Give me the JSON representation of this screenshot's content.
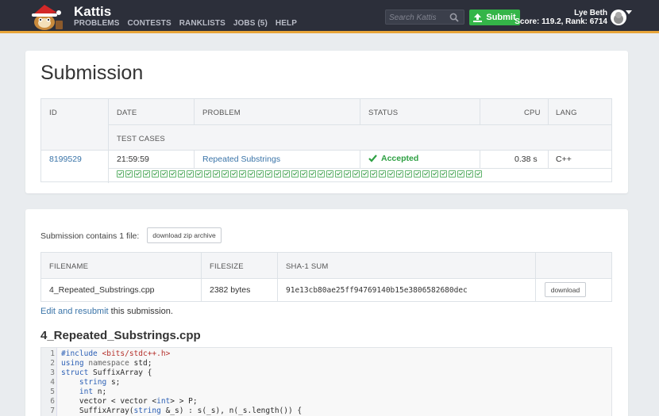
{
  "header": {
    "brand": "Kattis",
    "nav": [
      "PROBLEMS",
      "CONTESTS",
      "RANKLISTS",
      "JOBS (5)",
      "HELP"
    ],
    "search_placeholder": "Search Kattis",
    "submit_label": "Submit",
    "user_name": "Lye Beth",
    "user_score": "Score: 119.2, Rank: 6714",
    "accent_color": "#e8a53a",
    "submit_color": "#34b548"
  },
  "submission": {
    "title": "Submission",
    "columns": {
      "id": "ID",
      "date": "DATE",
      "problem": "PROBLEM",
      "status": "STATUS",
      "cpu": "CPU",
      "lang": "LANG",
      "test_cases": "TEST CASES"
    },
    "row": {
      "id": "8199529",
      "date": "21:59:59",
      "problem": "Repeated Substrings",
      "status": "Accepted",
      "cpu": "0.38 s",
      "lang": "C++"
    },
    "test_cases_passed": 42
  },
  "files": {
    "summary": "Submission contains 1 file:",
    "download_zip_label": "download zip archive",
    "columns": {
      "filename": "FILENAME",
      "filesize": "FILESIZE",
      "sha1": "SHA-1 SUM"
    },
    "row": {
      "filename": "4_Repeated_Substrings.cpp",
      "filesize": "2382 bytes",
      "sha1": "91e13cb80ae25ff94769140b15e3806582680dec",
      "download_label": "download"
    },
    "resubmit_link": "Edit and resubmit",
    "resubmit_suffix": " this submission.",
    "file_title": "4_Repeated_Substrings.cpp",
    "code_lines": [
      "#include <bits/stdc++.h>",
      "using namespace std;",
      "struct SuffixArray {",
      "    string s;",
      "    int n;",
      "    vector < vector <int> > P;",
      "    SuffixArray(string &_s) : s(_s), n(_s.length()) {"
    ]
  }
}
